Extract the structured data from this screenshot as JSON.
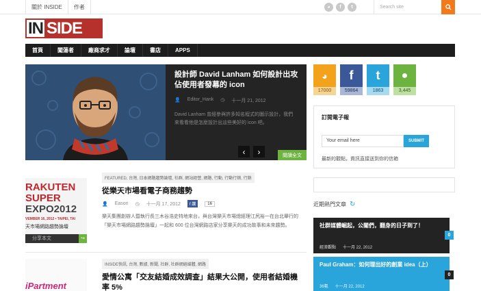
{
  "topbar": {
    "links": [
      "關於 INSIDE",
      "作者"
    ],
    "search_placeholder": "Search site"
  },
  "logo": {
    "in": "IN",
    "side": "SIDE"
  },
  "nav": {
    "items": [
      "首頁",
      "闖蕩者",
      "廠商求才",
      "論壇",
      "書店",
      "APPS"
    ]
  },
  "featured": {
    "title": "設計師 David Lanham 如何設計出攻佔使用者發幕的 icon",
    "author": "Editor_Hank",
    "date": "十一月 21, 2012",
    "excerpt": "David Lanham 曾經參與許多知名程式的圖示設計，我們來看看他是怎麼設計出這些美好的 icon 吧。",
    "read_more": "閱讀全文",
    "prev": "‹",
    "next": "›"
  },
  "posts": [
    {
      "tags": "FEATURED, 台灣, 日本網路趨勢論壇, 社群, 網站經營, 網路, 行動, 行動行銷, 行銷",
      "title": "從樂天市場看電子商務趨勢",
      "author": "Eason",
      "date": "十一月 17, 2012",
      "like_count": "16",
      "excerpt": "樂天集團創辦人暨執行長三木谷浩史特地來台，與台灣樂天市場總經理江尻裕一在台北舉行的「樂天市場網路趨勢論壇」一起和 600 位台灣網路店家分享樂天的成功故事和未來趨勢。",
      "share": "分享本文",
      "thumb_text": [
        "RAKUTEN",
        "SUPER",
        "EXPO2012",
        "VEMBER 16, 2012 • TAIPEI, TAI",
        "天市場網路趨勢論壇"
      ]
    },
    {
      "tags": "INSIDE快訊, 台灣, 數據, 新聞, 社群, 社群網絡媒體, 網路",
      "title": "愛情公寓「交友結婚成效調查」結果大公開，使用者結婚機率 5%",
      "thumb_text": [
        "iPartment"
      ]
    }
  ],
  "social": [
    {
      "icon": "rss-icon",
      "symbol": "◕",
      "count": "17000",
      "bg": "#f2a31b",
      "cbg": "#f6d594"
    },
    {
      "icon": "facebook-icon",
      "symbol": "f",
      "count": "59864",
      "bg": "#3b5998",
      "cbg": "#a9b7d6"
    },
    {
      "icon": "twitter-icon",
      "symbol": "t",
      "count": "1863",
      "bg": "#2aa5dc",
      "cbg": "#a6daf0"
    },
    {
      "icon": "chat-icon",
      "symbol": "●",
      "count": "3,445",
      "bg": "#6db33f",
      "cbg": "#bfe0a3"
    }
  ],
  "subscribe": {
    "heading": "訂閱電子報",
    "email_value": "Your email here",
    "submit": "SUBMIT",
    "description": "最新的觀點，資訊直接送到你的信箱"
  },
  "hot": {
    "label": "近期熱門文章",
    "items": [
      {
        "title": "社群媒體崛起，公關們，翻身的日子到了！",
        "author": "經濟觀點",
        "date": "十一月 22, 2012",
        "count": "0",
        "bg": "#232323"
      },
      {
        "title": "Paul Graham：如何理出好的創業 idea（上）",
        "author": "36氪",
        "date": "十一月 22, 2012",
        "count": "0",
        "bg": "#2aa5dc"
      }
    ]
  },
  "colors": {
    "accent": "#b7312c",
    "nav": "#1d1d1d",
    "green": "#6db33f",
    "blue": "#2aa5dc",
    "orange": "#f27a1a"
  }
}
